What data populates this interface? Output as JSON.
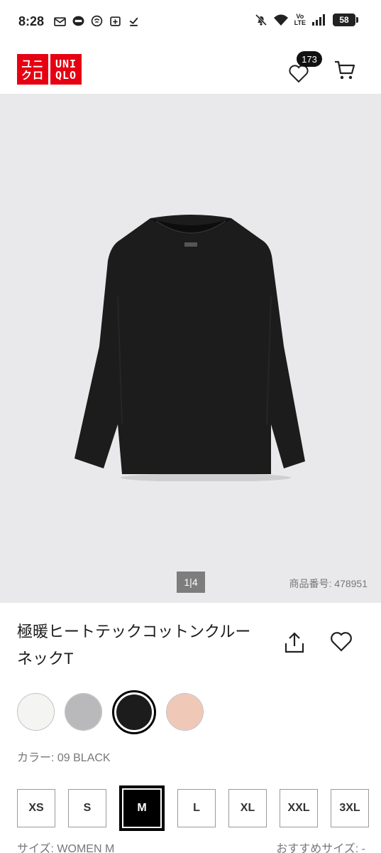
{
  "status_bar": {
    "time": "8:28",
    "battery": "58",
    "network": "Vo LTE"
  },
  "header": {
    "logo_left": [
      "ユニ",
      "クロ"
    ],
    "logo_right": [
      "UNI",
      "QLO"
    ],
    "wishlist_count": "173"
  },
  "gallery": {
    "pager": "1|4",
    "product_number": "商品番号: 478951",
    "shirt_color": "#1c1c1c"
  },
  "product": {
    "title": "極暖ヒートテックコットンクルーネックT",
    "color_label": "カラー: 09 BLACK",
    "swatches": [
      {
        "name": "white",
        "color": "#f4f4f2"
      },
      {
        "name": "gray",
        "color": "#b9b9bb"
      },
      {
        "name": "black",
        "color": "#1c1c1c",
        "selected": true
      },
      {
        "name": "pink",
        "color": "#efc8b8"
      }
    ],
    "sizes": [
      "XS",
      "S",
      "M",
      "L",
      "XL",
      "XXL",
      "3XL"
    ],
    "selected_size": "M",
    "size_label": "サイズ: WOMEN M",
    "recommended_size": "おすすめサイズ: -"
  },
  "colors": {
    "brand_red": "#e60012",
    "gallery_bg": "#e9e9eb"
  }
}
